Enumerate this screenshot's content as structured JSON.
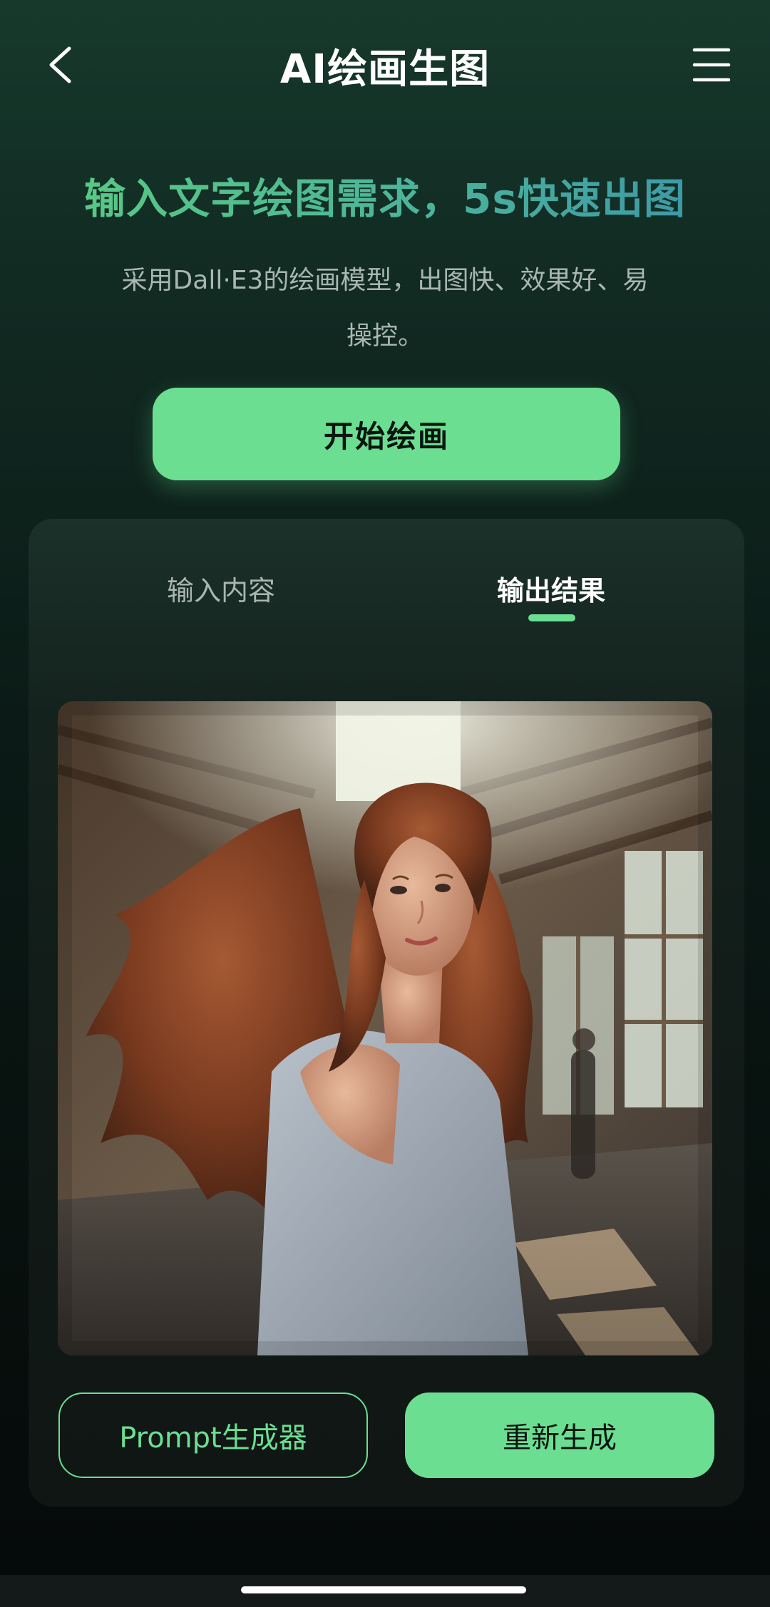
{
  "header": {
    "title": "AI绘画生图",
    "back_icon": "chevron-left-icon",
    "menu_icon": "hamburger-menu-icon"
  },
  "hero": {
    "headline": "输入文字绘图需求，5s快速出图",
    "subtitle": "采用Dall·E3的绘画模型，出图快、效果好、易操控。",
    "start_button": "开始绘画"
  },
  "tabs": [
    {
      "label": "输入内容",
      "active": false
    },
    {
      "label": "输出结果",
      "active": true
    }
  ],
  "result": {
    "image": "generated-portrait-image",
    "prompt_button": "Prompt生成器",
    "regenerate_button": "重新生成"
  },
  "colors": {
    "accent": "#6cde92",
    "headline_start": "#58c884",
    "headline_end": "#3e9aa6",
    "background": "#0b1a16",
    "muted_text": "#a9b6b1"
  }
}
